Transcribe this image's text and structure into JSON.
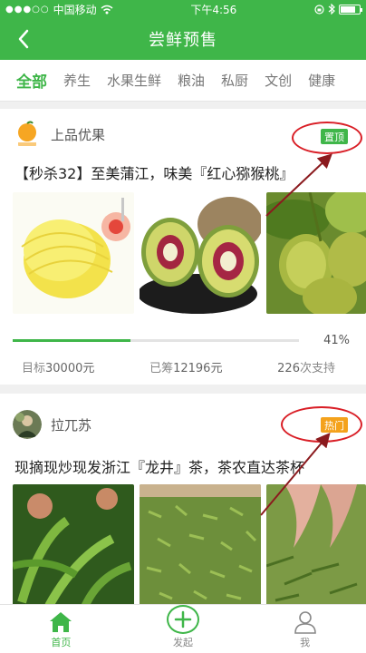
{
  "status_bar": {
    "carrier": "中国移动",
    "time": "下午4:56"
  },
  "nav": {
    "title": "尝鲜预售"
  },
  "categories": [
    "全部",
    "养生",
    "水果生鲜",
    "粮油",
    "私厨",
    "文创",
    "健康"
  ],
  "cards": [
    {
      "author": "上品优果",
      "badge": "置顶",
      "title": "【秒杀32】至美蒲江，味美『红心猕猴桃』",
      "progress_percent": 41,
      "progress_label": "41%",
      "target_label": "目标",
      "target_value": "30000元",
      "raised_label": "已筹",
      "raised_value": "12196元",
      "supporters_value": "226",
      "supporters_label": "次支持"
    },
    {
      "author": "拉兀苏",
      "badge": "热门",
      "title": "现摘现炒现发浙江『龙井』茶，茶农直达茶杯"
    }
  ],
  "tabbar": {
    "home": "首页",
    "launch": "发起",
    "me": "我"
  },
  "colors": {
    "primary": "#3fb649",
    "hot": "#f4a21c",
    "annotation": "#d91e26"
  }
}
